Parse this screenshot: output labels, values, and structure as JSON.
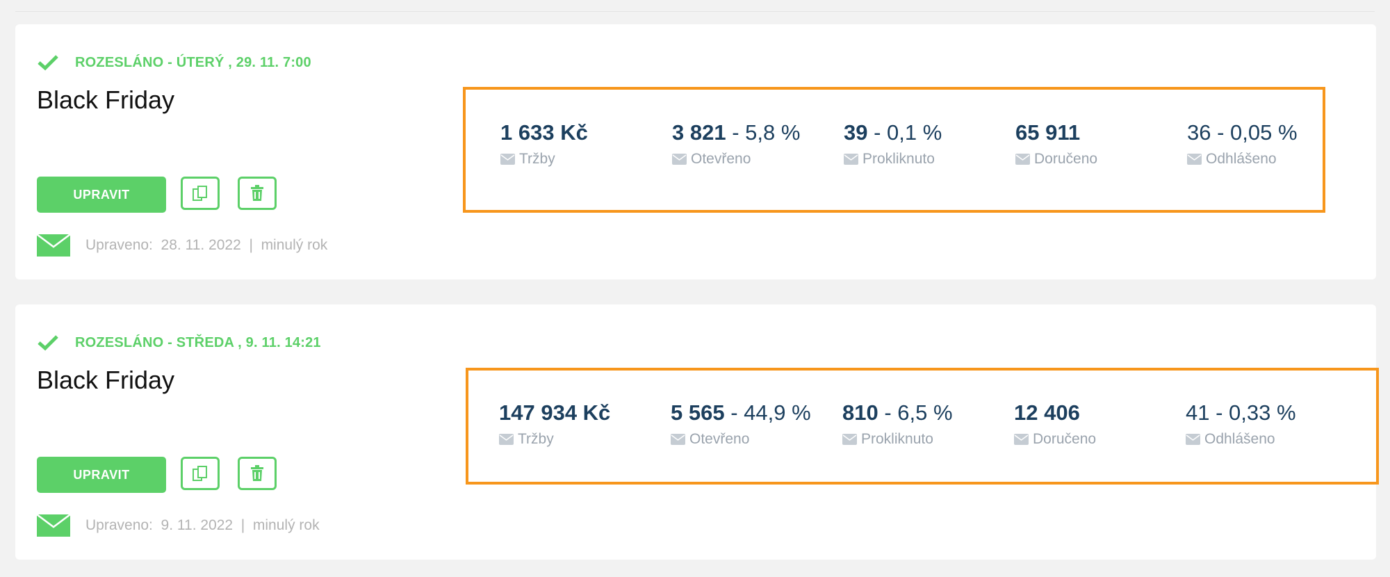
{
  "colors": {
    "accent": "#5cd068",
    "highlight_border": "#f7961c",
    "stat_text": "#1c3f5e"
  },
  "campaigns": [
    {
      "status": "ROZESLÁNO - ÚTERÝ , 29. 11. 7:00",
      "title": "Black Friday",
      "edit_label": "UPRAVIT",
      "copy_icon": "copy-icon",
      "delete_icon": "trash-icon",
      "modified": "Upraveno:  28. 11. 2022  |  minulý rok",
      "stats": [
        {
          "value": "1 633 Kč",
          "suffix": "",
          "label": "Tržby"
        },
        {
          "value": "3 821",
          "suffix": " - 5,8 %",
          "label": "Otevřeno"
        },
        {
          "value": "39",
          "suffix": " - 0,1 %",
          "label": "Prokliknuto"
        },
        {
          "value": "65 911",
          "suffix": "",
          "label": "Doručeno"
        },
        {
          "value": "",
          "suffix": "36 - 0,05 %",
          "label": "Odhlášeno"
        }
      ]
    },
    {
      "status": "ROZESLÁNO - STŘEDA , 9. 11. 14:21",
      "title": "Black Friday",
      "edit_label": "UPRAVIT",
      "copy_icon": "copy-icon",
      "delete_icon": "trash-icon",
      "modified": "Upraveno:  9. 11. 2022  |  minulý rok",
      "stats": [
        {
          "value": "147 934 Kč",
          "suffix": "",
          "label": "Tržby"
        },
        {
          "value": "5 565",
          "suffix": " - 44,9 %",
          "label": "Otevřeno"
        },
        {
          "value": "810",
          "suffix": " - 6,5 %",
          "label": "Prokliknuto"
        },
        {
          "value": "12 406",
          "suffix": "",
          "label": "Doručeno"
        },
        {
          "value": "",
          "suffix": "41 - 0,33 %",
          "label": "Odhlášeno"
        }
      ]
    }
  ]
}
